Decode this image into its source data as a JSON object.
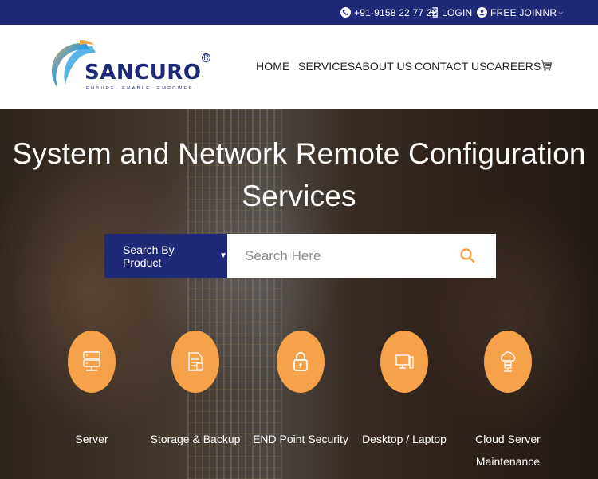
{
  "topbar": {
    "phone": "+91-9158 22 77 22",
    "login": "LOGIN",
    "free_join": "FREE JOIN",
    "currency": "INR"
  },
  "brand": {
    "name": "SANCURO",
    "tagline": "ENSURE. ENABLE. EMPOWER.",
    "registered": "R"
  },
  "nav": {
    "items": [
      "HOME",
      "SERVICES",
      "ABOUT US",
      "CONTACT US",
      "CAREERS"
    ]
  },
  "hero": {
    "title_line1": "System and Network Remote Configuration",
    "title_line2": "Services"
  },
  "search": {
    "category_label": "Search By Product",
    "placeholder": "Search Here"
  },
  "services": [
    {
      "label": "Server",
      "icon": "server-icon"
    },
    {
      "label": "Storage & Backup",
      "icon": "storage-icon"
    },
    {
      "label": "END Point Security",
      "icon": "lock-icon"
    },
    {
      "label": "Desktop / Laptop",
      "icon": "desktop-icon"
    },
    {
      "label": "Cloud Server Maintenance",
      "icon": "cloud-server-icon"
    }
  ],
  "colors": {
    "brand_navy": "#1e2a78",
    "accent_orange": "#f5a24a"
  }
}
